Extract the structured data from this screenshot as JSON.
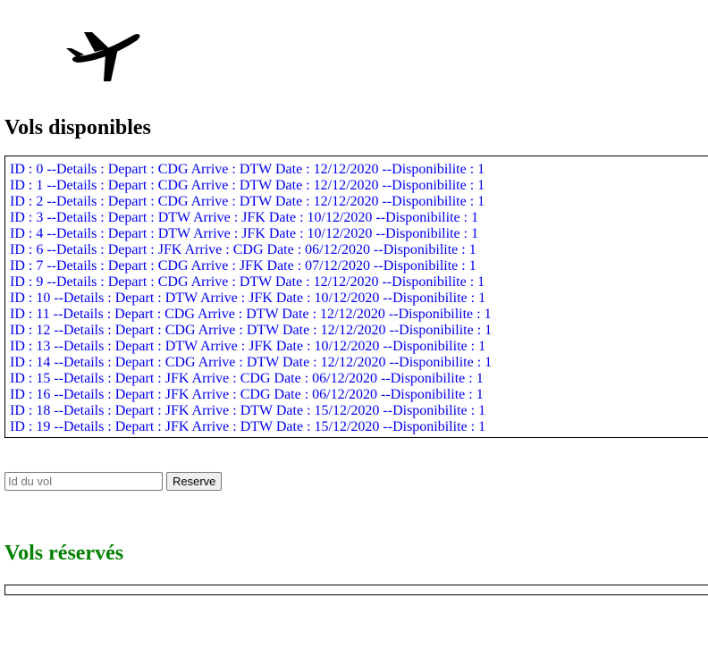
{
  "logo": {
    "icon": "airplane-icon"
  },
  "available_section": {
    "title": "Vols disponibles",
    "flights": [
      "ID : 0 --Details : Depart : CDG Arrive : DTW Date : 12/12/2020 --Disponibilite : 1",
      "ID : 1 --Details : Depart : CDG Arrive : DTW Date : 12/12/2020 --Disponibilite : 1",
      "ID : 2 --Details : Depart : CDG Arrive : DTW Date : 12/12/2020 --Disponibilite : 1",
      "ID : 3 --Details : Depart : DTW Arrive : JFK Date : 10/12/2020 --Disponibilite : 1",
      "ID : 4 --Details : Depart : DTW Arrive : JFK Date : 10/12/2020 --Disponibilite : 1",
      "ID : 6 --Details : Depart : JFK Arrive : CDG Date : 06/12/2020 --Disponibilite : 1",
      "ID : 7 --Details : Depart : CDG Arrive : JFK Date : 07/12/2020 --Disponibilite : 1",
      "ID : 9 --Details : Depart : CDG Arrive : DTW Date : 12/12/2020 --Disponibilite : 1",
      "ID : 10 --Details : Depart : DTW Arrive : JFK Date : 10/12/2020 --Disponibilite : 1",
      "ID : 11 --Details : Depart : CDG Arrive : DTW Date : 12/12/2020 --Disponibilite : 1",
      "ID : 12 --Details : Depart : CDG Arrive : DTW Date : 12/12/2020 --Disponibilite : 1",
      "ID : 13 --Details : Depart : DTW Arrive : JFK Date : 10/12/2020 --Disponibilite : 1",
      "ID : 14 --Details : Depart : CDG Arrive : DTW Date : 12/12/2020 --Disponibilite : 1",
      "ID : 15 --Details : Depart : JFK Arrive : CDG Date : 06/12/2020 --Disponibilite : 1",
      "ID : 16 --Details : Depart : JFK Arrive : CDG Date : 06/12/2020 --Disponibilite : 1",
      "ID : 18 --Details : Depart : JFK Arrive : DTW Date : 15/12/2020 --Disponibilite : 1",
      "ID : 19 --Details : Depart : JFK Arrive : DTW Date : 15/12/2020 --Disponibilite : 1"
    ]
  },
  "reserve_form": {
    "input_placeholder": "Id du vol",
    "input_value": "",
    "button_label": "Reserve"
  },
  "reserved_section": {
    "title": "Vols réservés",
    "flights": []
  },
  "colors": {
    "link": "#0000ee",
    "reserved_title": "#008000",
    "border": "#000000"
  }
}
